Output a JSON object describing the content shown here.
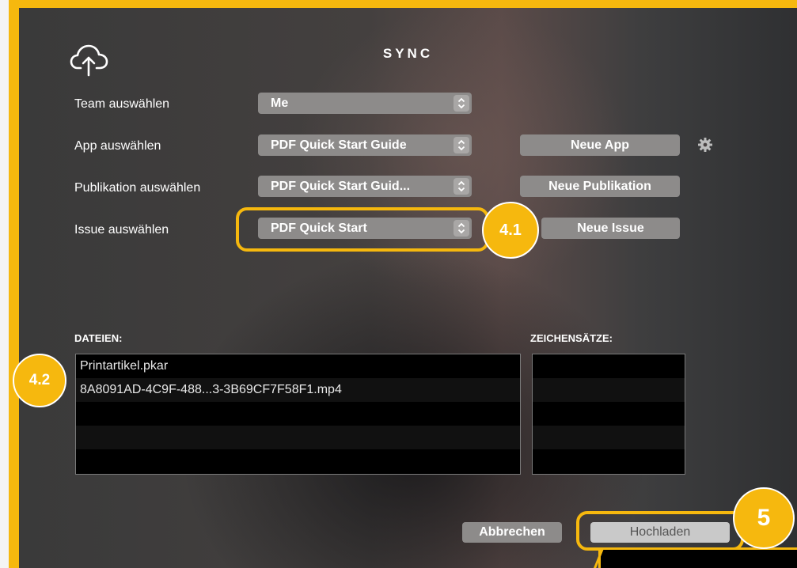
{
  "dialog": {
    "title": "SYNC",
    "icon": "cloud-upload-icon"
  },
  "form": {
    "team": {
      "label": "Team auswählen",
      "value": "Me"
    },
    "app": {
      "label": "App auswählen",
      "value": "PDF Quick Start Guide",
      "button": "Neue App"
    },
    "publication": {
      "label": "Publikation auswählen",
      "value": "PDF Quick Start Guid...",
      "button": "Neue Publikation"
    },
    "issue": {
      "label": "Issue auswählen",
      "value": "PDF Quick Start",
      "button": "Neue Issue"
    }
  },
  "files": {
    "label": "DATEIEN:",
    "items": [
      "Printartikel.pkar",
      "8A8091AD-4C9F-488...3-3B69CF7F58F1.mp4"
    ]
  },
  "fonts": {
    "label": "ZEICHENSÄTZE:",
    "items": []
  },
  "actions": {
    "cancel": "Abbrechen",
    "upload": "Hochladen"
  },
  "annotations": {
    "issue_badge": "4.1",
    "files_badge": "4.2",
    "upload_badge": "5",
    "accent_color": "#f6b80e"
  }
}
